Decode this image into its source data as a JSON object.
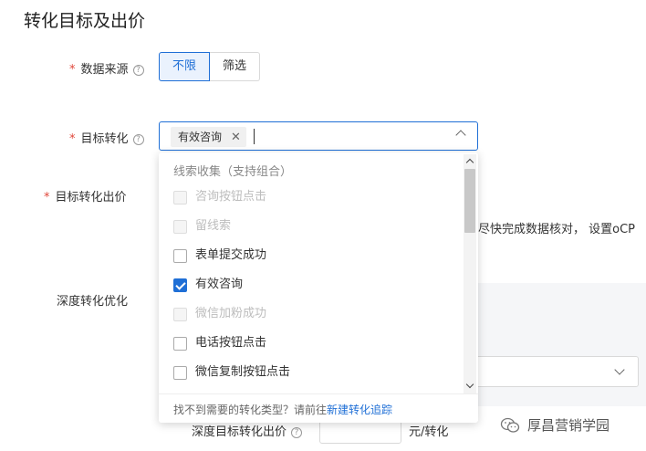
{
  "page": {
    "title": "转化目标及出价"
  },
  "data_source": {
    "label": "数据来源",
    "required_mark": "*",
    "help_icon": "help-circle-icon",
    "options": [
      {
        "label": "不限",
        "selected": true
      },
      {
        "label": "筛选",
        "selected": false
      }
    ]
  },
  "target_conversion": {
    "label": "目标转化",
    "required_mark": "*",
    "help_icon": "help-circle-icon",
    "tag": "有效咨询",
    "tag_remove": "✕"
  },
  "target_bid": {
    "label": "目标转化出价",
    "required_mark": "*"
  },
  "deep_optimization": {
    "label": "深度转化优化"
  },
  "background_text": "尽快完成数据核对， 设置oCP",
  "deep_bid": {
    "label": "深度目标转化出价",
    "help_icon": "help-circle-icon",
    "unit": "元/转化"
  },
  "dropdown": {
    "group_title": "线索收集（支持组合）",
    "items": [
      {
        "label": "咨询按钮点击",
        "checked": false,
        "disabled": true
      },
      {
        "label": "留线索",
        "checked": false,
        "disabled": true
      },
      {
        "label": "表单提交成功",
        "checked": false,
        "disabled": false
      },
      {
        "label": "有效咨询",
        "checked": true,
        "disabled": false
      },
      {
        "label": "微信加粉成功",
        "checked": false,
        "disabled": true
      },
      {
        "label": "电话按钮点击",
        "checked": false,
        "disabled": false
      },
      {
        "label": "微信复制按钮点击",
        "checked": false,
        "disabled": false
      }
    ],
    "footer_hint": "找不到需要的转化类型？请前往",
    "footer_link": "新建转化追踪"
  },
  "watermark": {
    "text": "厚昌营销学园",
    "icon": "wechat-icon"
  },
  "colors": {
    "primary": "#1f6fd6",
    "required": "#e0473b"
  }
}
